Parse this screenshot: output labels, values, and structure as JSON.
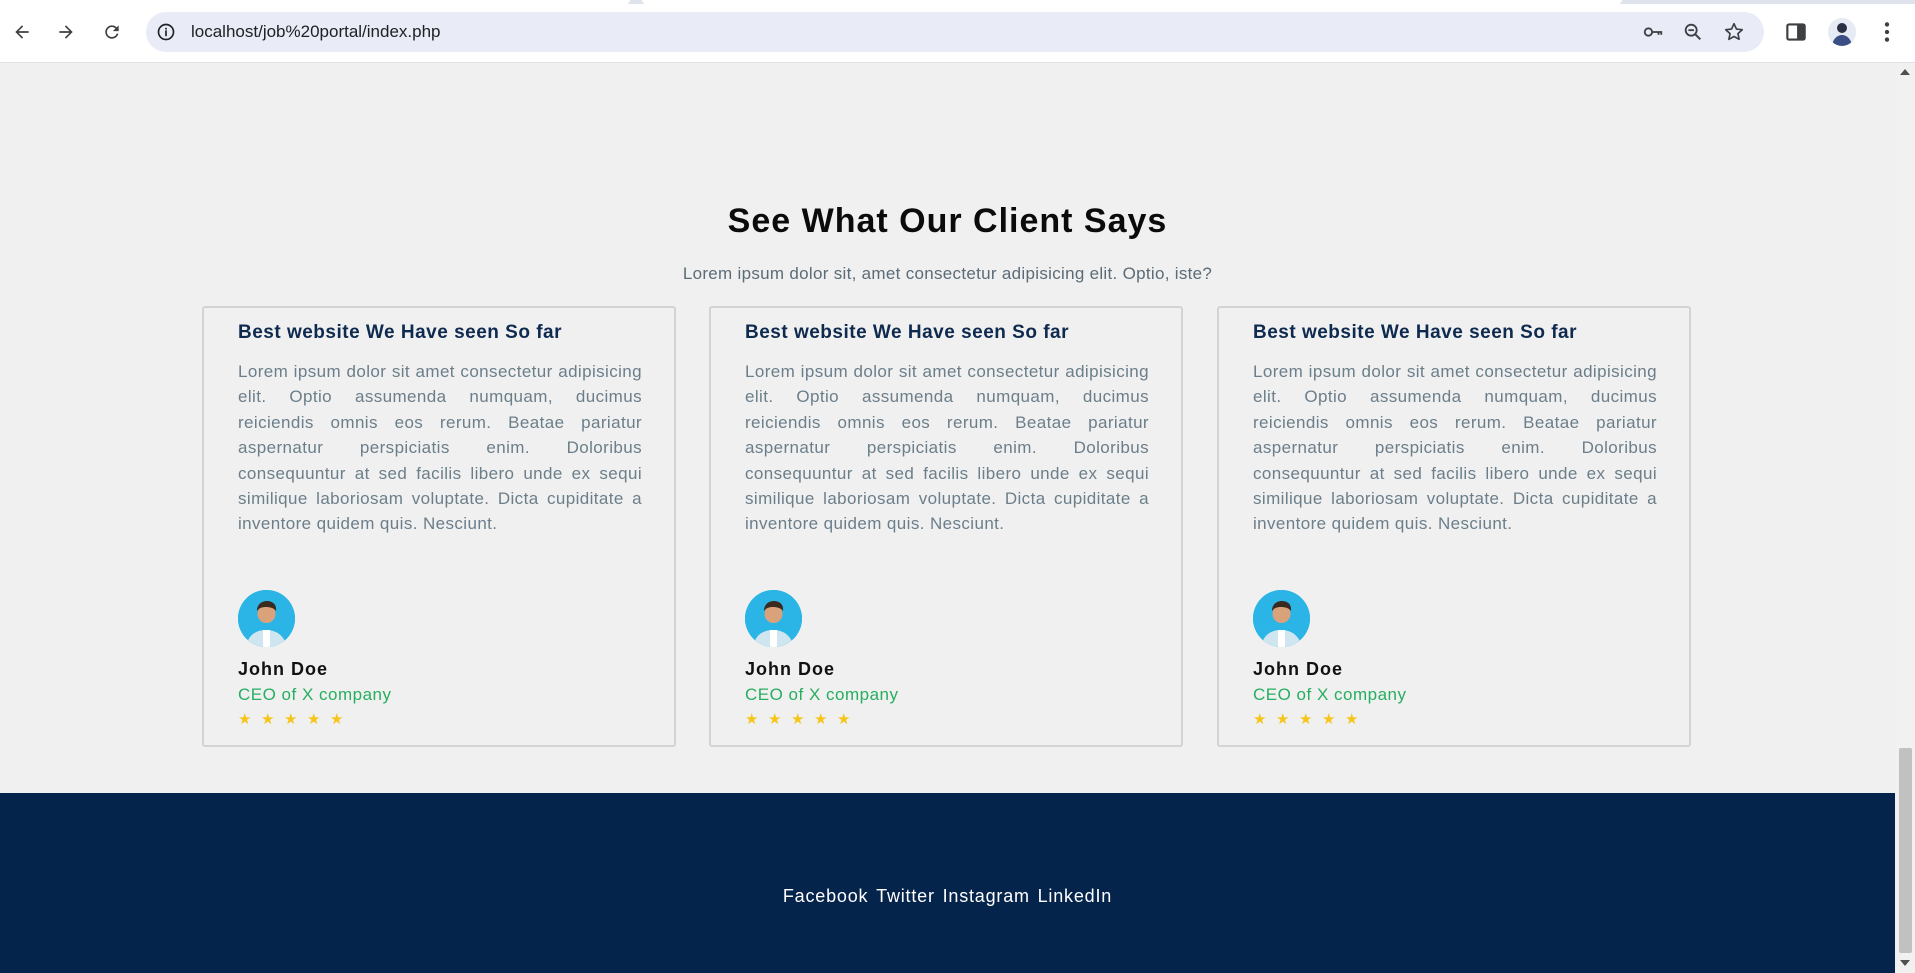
{
  "browser": {
    "url": "localhost/job%20portal/index.php",
    "icons": {
      "back": "back-arrow-icon",
      "forward": "forward-arrow-icon",
      "reload": "reload-icon",
      "site_info": "info-icon",
      "password": "key-icon",
      "zoom": "zoom-out-icon",
      "bookmark": "star-icon",
      "side_panel": "side-panel-icon",
      "profile": "avatar",
      "menu": "kebab-menu-icon"
    }
  },
  "testimonials": {
    "title": "See What Our Client Says",
    "subtitle": "Lorem ipsum dolor sit, amet consectetur adipisicing elit. Optio, iste?",
    "cards": [
      {
        "heading": "Best website We Have seen So far",
        "body": "Lorem ipsum dolor sit amet consectetur adipisicing elit. Optio assumenda numquam, ducimus reiciendis omnis eos rerum. Beatae pariatur aspernatur perspiciatis enim. Doloribus consequuntur at sed facilis libero unde ex sequi similique laboriosam voluptate. Dicta cupiditate a inventore quidem quis. Nesciunt.",
        "name": "John Doe",
        "role": "CEO of X company",
        "rating": 5
      },
      {
        "heading": "Best website We Have seen So far",
        "body": "Lorem ipsum dolor sit amet consectetur adipisicing elit. Optio assumenda numquam, ducimus reiciendis omnis eos rerum. Beatae pariatur aspernatur perspiciatis enim. Doloribus consequuntur at sed facilis libero unde ex sequi similique laboriosam voluptate. Dicta cupiditate a inventore quidem quis. Nesciunt.",
        "name": "John Doe",
        "role": "CEO of X company",
        "rating": 5
      },
      {
        "heading": "Best website We Have seen So far",
        "body": "Lorem ipsum dolor sit amet consectetur adipisicing elit. Optio assumenda numquam, ducimus reiciendis omnis eos rerum. Beatae pariatur aspernatur perspiciatis enim. Doloribus consequuntur at sed facilis libero unde ex sequi similique laboriosam voluptate. Dicta cupiditate a inventore quidem quis. Nesciunt.",
        "name": "John Doe",
        "role": "CEO of X company",
        "rating": 5
      }
    ]
  },
  "footer": {
    "links": [
      "Facebook",
      "Twitter",
      "Instagram",
      "LinkedIn"
    ]
  },
  "colors": {
    "footer_bg": "#05244c",
    "role_green": "#27ae60",
    "star_gold": "#f5c518",
    "heading_navy": "#0e2a4f"
  }
}
